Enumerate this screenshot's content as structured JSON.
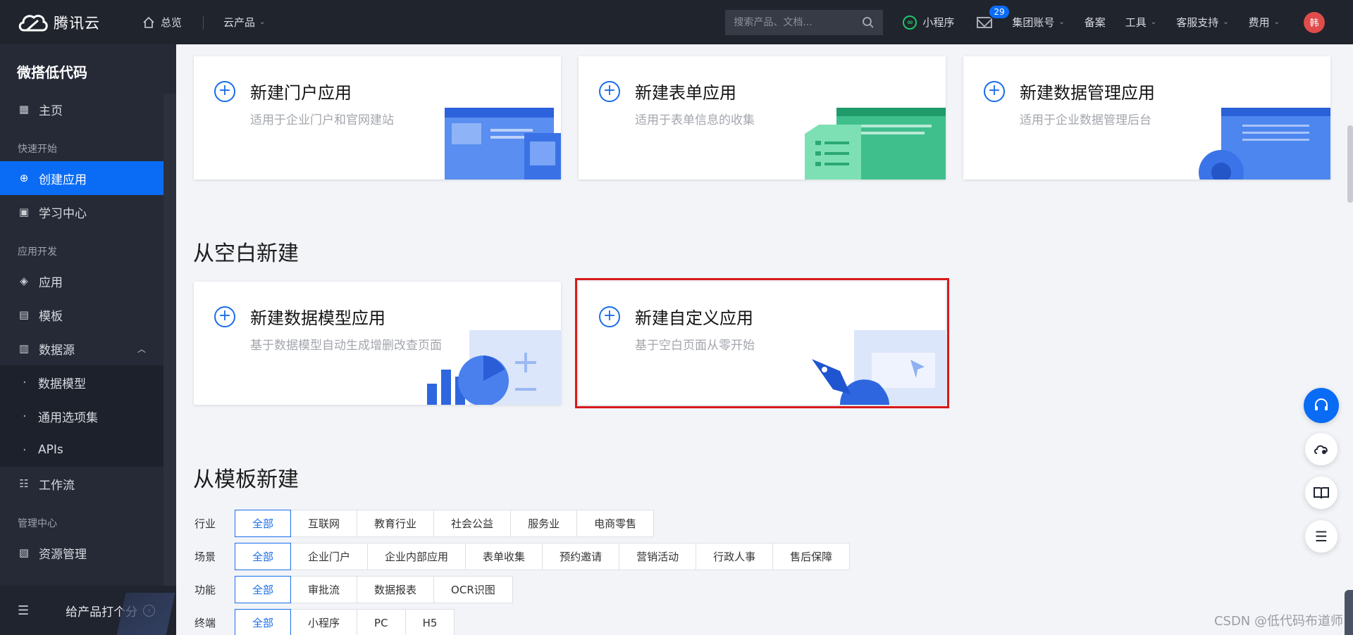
{
  "topbar": {
    "brand": "腾讯云",
    "overview": "总览",
    "products": "云产品",
    "search_placeholder": "搜索产品、文档...",
    "mini_program": "小程序",
    "mail_badge": "29",
    "group_account": "集团账号",
    "beian": "备案",
    "tools": "工具",
    "support": "客服支持",
    "billing": "费用",
    "avatar": "韩"
  },
  "sidebar": {
    "title": "微搭低代码",
    "home": "主页",
    "group_quick": "快速开始",
    "create_app": "创建应用",
    "learn": "学习中心",
    "group_dev": "应用开发",
    "apps": "应用",
    "templates": "模板",
    "datasource": "数据源",
    "sub_items": [
      "数据模型",
      "通用选项集",
      "APIs"
    ],
    "workflow": "工作流",
    "group_manage": "管理中心",
    "resources": "资源管理",
    "rate": "给产品打个分"
  },
  "cards_top": [
    {
      "title": "新建门户应用",
      "desc": "适用于企业门户和官网建站"
    },
    {
      "title": "新建表单应用",
      "desc": "适用于表单信息的收集"
    },
    {
      "title": "新建数据管理应用",
      "desc": "适用于企业数据管理后台"
    }
  ],
  "section_blank": "从空白新建",
  "cards_blank": [
    {
      "title": "新建数据模型应用",
      "desc": "基于数据模型自动生成增删改查页面"
    },
    {
      "title": "新建自定义应用",
      "desc": "基于空白页面从零开始"
    }
  ],
  "section_template": "从模板新建",
  "filters": [
    {
      "label": "行业",
      "tags": [
        "全部",
        "互联网",
        "教育行业",
        "社会公益",
        "服务业",
        "电商零售"
      ]
    },
    {
      "label": "场景",
      "tags": [
        "全部",
        "企业门户",
        "企业内部应用",
        "表单收集",
        "预约邀请",
        "营销活动",
        "行政人事",
        "售后保障"
      ]
    },
    {
      "label": "功能",
      "tags": [
        "全部",
        "审批流",
        "数据报表",
        "OCR识图"
      ]
    },
    {
      "label": "终端",
      "tags": [
        "全部",
        "小程序",
        "PC",
        "H5"
      ]
    }
  ],
  "watermark": "CSDN @低代码布道师",
  "colors": {
    "accent": "#0a6cf5",
    "highlight": "#d71a1a",
    "sidebar_bg": "#252a36",
    "topbar_bg": "#20242d"
  }
}
